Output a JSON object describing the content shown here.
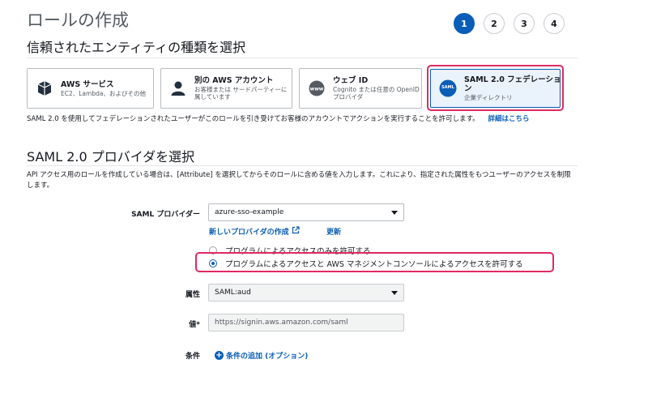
{
  "header": {
    "title": "ロールの作成",
    "steps": [
      "1",
      "2",
      "3",
      "4"
    ]
  },
  "entity_section": {
    "title": "信頼されたエンティティの種類を選択",
    "cards": [
      {
        "name": "AWS サービス",
        "desc": "EC2、Lambda、およびその他",
        "icon": "cube-icon"
      },
      {
        "name": "別の AWS アカウント",
        "desc": "お客様または サードパーティーに属しています",
        "icon": "user-icon"
      },
      {
        "name": "ウェブ ID",
        "desc": "Cognito または任意の OpenID プロバイダ",
        "icon": "www-icon"
      },
      {
        "name": "SAML 2.0 フェデレーション",
        "desc": "企業ディレクトリ",
        "icon": "saml-icon",
        "icon_text": "SAML"
      }
    ],
    "description": "SAML 2.0 を使用してフェデレーションされたユーザーがこのロールを引き受けてお客様のアカウントでアクションを実行することを許可します。",
    "details_link": "詳細はこちら"
  },
  "saml_section": {
    "title": "SAML 2.0 プロバイダを選択",
    "description": "API アクセス用のロールを作成している場合は、[Attribute] を選択してからそのロールに含める値を入力します。これにより、指定された属性をもつユーザーのアクセスを制限します。",
    "provider_label": "SAML プロバイダー",
    "provider_value": "azure-sso-example",
    "create_provider_link": "新しいプロバイダの作成",
    "refresh_link": "更新",
    "radio_options": [
      {
        "label": "プログラムによるアクセスのみを許可する",
        "checked": false
      },
      {
        "label": "プログラムによるアクセスと AWS マネジメントコンソールによるアクセスを許可する",
        "checked": true
      }
    ],
    "attribute_label": "属性",
    "attribute_value": "SAML:aud",
    "value_label": "値*",
    "value_value": "https://signin.aws.amazon.com/saml",
    "condition_label": "条件",
    "add_condition_link": "条件の追加 (オプション)"
  },
  "colors": {
    "accent": "#0a5eb7",
    "highlight": "#e02a62"
  }
}
